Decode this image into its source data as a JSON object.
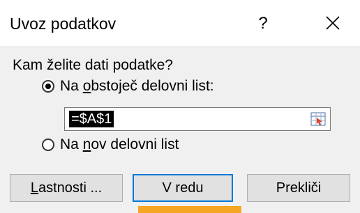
{
  "window": {
    "title": "Uvoz podatkov",
    "help_label": "?"
  },
  "dialog": {
    "question": "Kam želite dati podatke?",
    "option_existing": {
      "prefix": "Na ",
      "underlined": "o",
      "suffix": "bstoječ delovni list:",
      "selected": true
    },
    "reference": {
      "value": "=$A$1"
    },
    "option_new": {
      "prefix": "Na ",
      "underlined": "n",
      "suffix": "ov delovni list",
      "selected": false
    }
  },
  "buttons": {
    "properties": {
      "underlined": "L",
      "rest": "astnosti ..."
    },
    "ok": "V redu",
    "cancel": "Prekliči"
  },
  "icons": {
    "close": "close-icon",
    "range_picker": "range-picker-icon"
  },
  "colors": {
    "accent": "#0078d7",
    "highlight_bar": "#f5a623"
  }
}
